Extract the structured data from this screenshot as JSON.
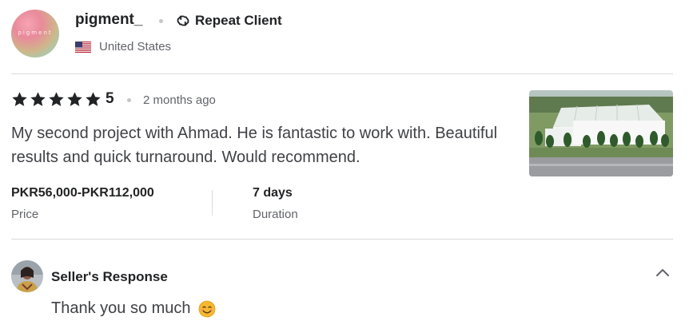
{
  "reviewer": {
    "avatar_text": "pigment",
    "username": "pigment_",
    "badge_label": "Repeat Client",
    "country": "United States"
  },
  "review": {
    "rating": "5",
    "stars": 5,
    "time_ago": "2 months ago",
    "text": "My second project with Ahmad. He is fantastic to work with. Beautiful results and quick turnaround. Would recommend."
  },
  "stats": {
    "price_value": "PKR56,000-PKR112,000",
    "price_label": "Price",
    "duration_value": "7 days",
    "duration_label": "Duration"
  },
  "seller_response": {
    "title": "Seller's Response",
    "text": "Thank you so much"
  },
  "colors": {
    "star": "#222325",
    "text_dark": "#222325",
    "text_body": "#404145",
    "text_muted": "#62646a",
    "divider": "#dadbdd"
  }
}
